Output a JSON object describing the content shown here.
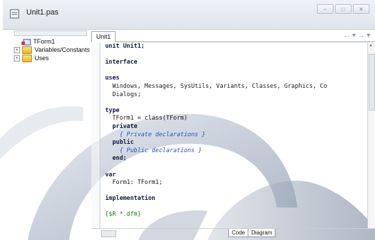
{
  "window": {
    "title": "Unit1.pas",
    "controls": [
      "minimize",
      "maximize",
      "close"
    ]
  },
  "structure_tree": {
    "items": [
      {
        "label": "TForm1",
        "icon": "form-icon",
        "expander": ""
      },
      {
        "label": "Variables/Constants",
        "icon": "folder-icon",
        "expander": "+"
      },
      {
        "label": "Uses",
        "icon": "folder-icon",
        "expander": "+"
      }
    ]
  },
  "editor": {
    "tab_label": "Unit1",
    "code_lines": [
      "unit Unit1;",
      "",
      "interface",
      "",
      "uses",
      "  Windows, Messages, SysUtils, Variants, Classes, Graphics, Co",
      "  Dialogs;",
      "",
      "type",
      "  TForm1 = class(TForm)",
      "  private",
      "    { Private declarations }",
      "  public",
      "    { Public declarations }",
      "  end;",
      "",
      "var",
      "  Form1: TForm1;",
      "",
      "implementation",
      "",
      "{$R *.dfm}"
    ],
    "bottom_tabs": [
      "Code",
      "Diagram"
    ]
  },
  "colors": {
    "keyword": "#121a3a",
    "comment": "#2a4dc4",
    "directive": "#1b7a1b",
    "swirl": "#7d8aa0"
  }
}
